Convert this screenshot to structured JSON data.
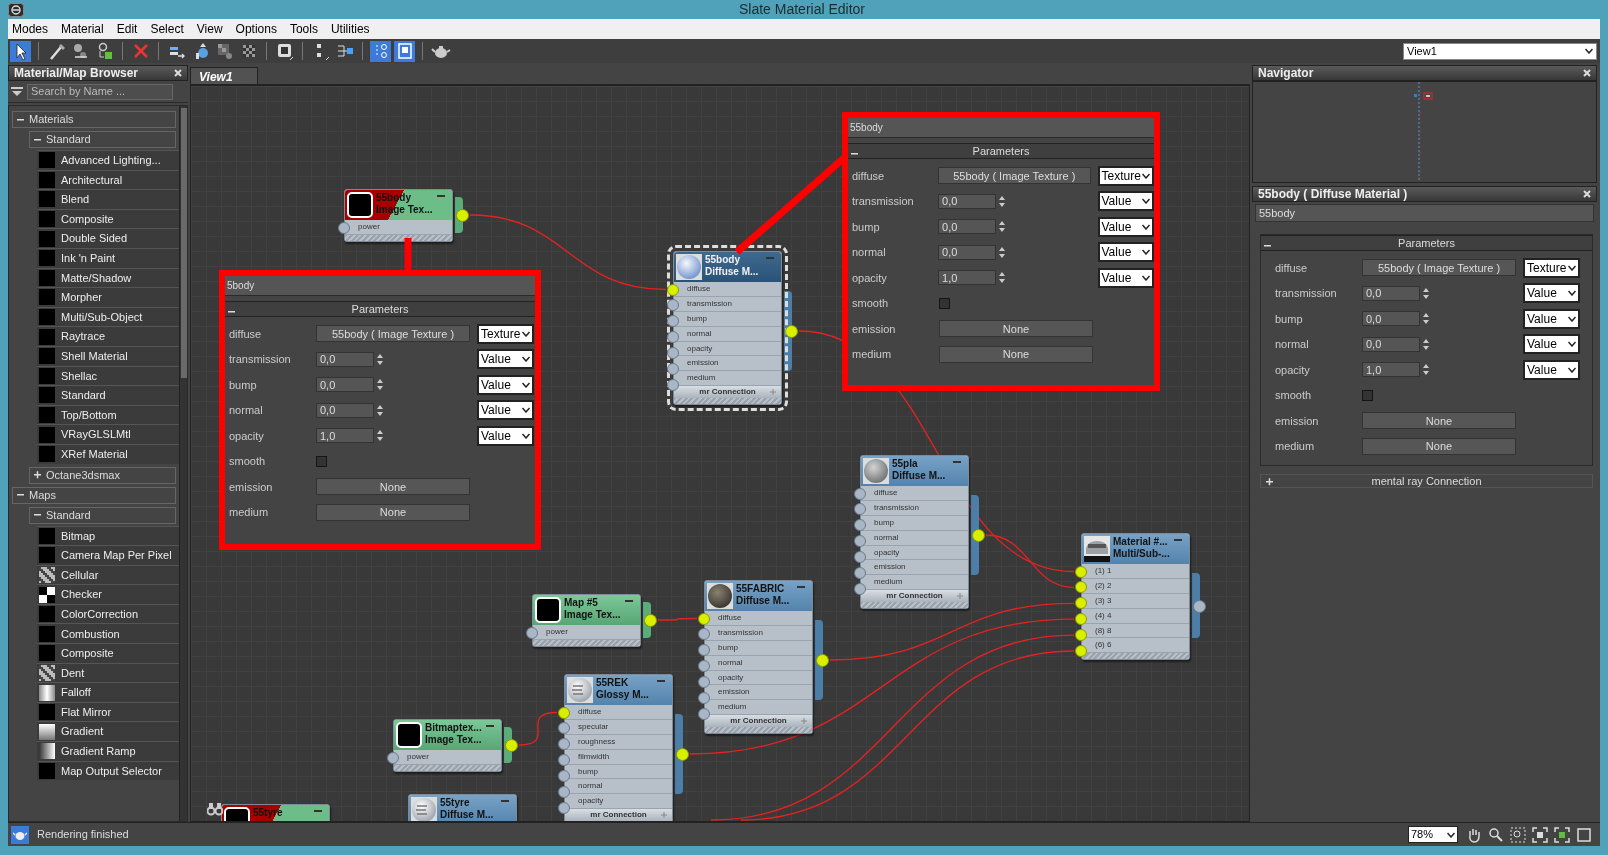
{
  "window": {
    "title": "Slate Material Editor"
  },
  "menu": [
    "Modes",
    "Material",
    "Edit",
    "Select",
    "View",
    "Options",
    "Tools",
    "Utilities"
  ],
  "toolbar": [
    [
      {
        "kind": "select",
        "selected": true
      }
    ],
    [
      {
        "kind": "pick",
        "selected": false
      },
      {
        "kind": "put",
        "selected": false
      },
      {
        "kind": "assign",
        "selected": false
      }
    ],
    [
      {
        "kind": "delete",
        "selected": false
      }
    ],
    [
      {
        "kind": "movechildren",
        "selected": false
      },
      {
        "kind": "hideunused",
        "selected": false
      },
      {
        "kind": "shaded",
        "selected": false
      },
      {
        "kind": "background",
        "selected": false
      }
    ],
    [
      {
        "kind": "showmap",
        "selected": false
      }
    ],
    [
      {
        "kind": "layoutall",
        "selected": false
      },
      {
        "kind": "layoutchildren",
        "selected": false
      }
    ],
    [
      {
        "kind": "navigator",
        "selected": true
      },
      {
        "kind": "parameters",
        "selected": true
      }
    ],
    [
      {
        "kind": "render",
        "selected": false
      }
    ]
  ],
  "view_selector": "View1",
  "browser": {
    "title": "Material/Map Browser",
    "search": {
      "placeholder": "Search by Name ..."
    },
    "groups": [
      {
        "label": "Materials",
        "expanded": true,
        "children": [
          {
            "label": "Standard",
            "expanded": true,
            "children": [
              {
                "label": "Advanced Lighting...",
                "kind": "black"
              },
              {
                "label": "Architectural",
                "kind": "black"
              },
              {
                "label": "Blend",
                "kind": "black"
              },
              {
                "label": "Composite",
                "kind": "black"
              },
              {
                "label": "Double Sided",
                "kind": "black"
              },
              {
                "label": "Ink 'n Paint",
                "kind": "black"
              },
              {
                "label": "Matte/Shadow",
                "kind": "black"
              },
              {
                "label": "Morpher",
                "kind": "black"
              },
              {
                "label": "Multi/Sub-Object",
                "kind": "black"
              },
              {
                "label": "Raytrace",
                "kind": "black"
              },
              {
                "label": "Shell Material",
                "kind": "black"
              },
              {
                "label": "Shellac",
                "kind": "black"
              },
              {
                "label": "Standard",
                "kind": "black"
              },
              {
                "label": "Top/Bottom",
                "kind": "black"
              },
              {
                "label": "VRayGLSLMtl",
                "kind": "black"
              },
              {
                "label": "XRef Material",
                "kind": "black"
              }
            ]
          },
          {
            "label": "Octane3dsmax",
            "expanded": false
          }
        ]
      },
      {
        "label": "Maps",
        "expanded": true,
        "children": [
          {
            "label": "Standard",
            "expanded": true,
            "children": [
              {
                "label": "Bitmap",
                "kind": "black"
              },
              {
                "label": "Camera Map Per Pixel",
                "kind": "black"
              },
              {
                "label": "Cellular",
                "kind": "noise"
              },
              {
                "label": "Checker",
                "kind": "checker"
              },
              {
                "label": "ColorCorrection",
                "kind": "black"
              },
              {
                "label": "Combustion",
                "kind": "black"
              },
              {
                "label": "Composite",
                "kind": "black"
              },
              {
                "label": "Dent",
                "kind": "noise"
              },
              {
                "label": "Falloff",
                "kind": "falloff"
              },
              {
                "label": "Flat Mirror",
                "kind": "black"
              },
              {
                "label": "Gradient",
                "kind": "gradient"
              },
              {
                "label": "Gradient Ramp",
                "kind": "ramp"
              },
              {
                "label": "Map Output Selector",
                "kind": "black"
              }
            ]
          }
        ]
      }
    ]
  },
  "view": {
    "tab": "View1",
    "nodes": [
      {
        "kind": "map",
        "title": "55body",
        "subtitle": "Image Tex...",
        "thumbnail": {
          "kind": "black"
        },
        "selected": false,
        "shown_in_viewport": true,
        "ports": [
          {
            "label": "power",
            "connected": false
          }
        ],
        "output_connected": true
      },
      {
        "kind": "material",
        "title": "55body",
        "subtitle": "Diffuse M...",
        "thumbnail": {
          "kind": "pale"
        },
        "selected": true,
        "shown_in_viewport": false,
        "ports": [
          {
            "label": "diffuse",
            "connected": true
          },
          {
            "label": "transmission",
            "connected": false
          },
          {
            "label": "bump",
            "connected": false
          },
          {
            "label": "normal",
            "connected": false
          },
          {
            "label": "opacity",
            "connected": false
          },
          {
            "label": "emission",
            "connected": false
          },
          {
            "label": "medium",
            "connected": false
          }
        ],
        "footer": "mr Connection",
        "output_connected": true
      },
      {
        "kind": "material",
        "title": "55pla",
        "subtitle": "Diffuse M...",
        "thumbnail": {
          "kind": "grey"
        },
        "selected": false,
        "shown_in_viewport": false,
        "ports": [
          {
            "label": "diffuse",
            "connected": false
          },
          {
            "label": "transmission",
            "connected": false
          },
          {
            "label": "bump",
            "connected": false
          },
          {
            "label": "normal",
            "connected": false
          },
          {
            "label": "opacity",
            "connected": false
          },
          {
            "label": "emission",
            "connected": false
          },
          {
            "label": "medium",
            "connected": false
          }
        ],
        "footer": "mr Connection",
        "output_connected": true
      },
      {
        "kind": "material",
        "title": "Material #...",
        "subtitle": "Multi/Sub-...",
        "thumbnail": {
          "kind": "car"
        },
        "selected": false,
        "shown_in_viewport": false,
        "ports": [
          {
            "label": "(1) 1",
            "connected": true
          },
          {
            "label": "(2) 2",
            "connected": true
          },
          {
            "label": "(3) 3",
            "connected": true
          },
          {
            "label": "(4) 4",
            "connected": true
          },
          {
            "label": "(8) 8",
            "connected": true
          },
          {
            "label": "(6) 6",
            "connected": true
          }
        ],
        "output_connected": false
      },
      {
        "kind": "map",
        "title": "Map #5",
        "subtitle": "Image Tex...",
        "thumbnail": {
          "kind": "black"
        },
        "selected": false,
        "shown_in_viewport": false,
        "ports": [
          {
            "label": "power",
            "connected": false
          }
        ],
        "output_connected": true
      },
      {
        "kind": "material",
        "title": "55FABRIC",
        "subtitle": "Diffuse M...",
        "thumbnail": {
          "kind": "dark"
        },
        "selected": false,
        "shown_in_viewport": false,
        "ports": [
          {
            "label": "diffuse",
            "connected": true
          },
          {
            "label": "transmission",
            "connected": false
          },
          {
            "label": "bump",
            "connected": false
          },
          {
            "label": "normal",
            "connected": false
          },
          {
            "label": "opacity",
            "connected": false
          },
          {
            "label": "emission",
            "connected": false
          },
          {
            "label": "medium",
            "connected": false
          }
        ],
        "footer": "mr Connection",
        "output_connected": true
      },
      {
        "kind": "map",
        "title": "55tyre",
        "thumbnail": {
          "kind": "black"
        },
        "selected": false,
        "shown_in_viewport": true
      },
      {
        "kind": "map",
        "title": "Bitmaptex...",
        "subtitle": "Image Tex...",
        "thumbnail": {
          "kind": "black"
        },
        "selected": false,
        "shown_in_viewport": false,
        "ports": [
          {
            "label": "power",
            "connected": false
          }
        ],
        "output_connected": true
      },
      {
        "kind": "material",
        "title": "55tyre",
        "subtitle": "Diffuse M...",
        "thumbnail": {
          "kind": "striped"
        },
        "selected": false,
        "shown_in_viewport": false
      },
      {
        "kind": "material",
        "title": "55REK",
        "subtitle": "Glossy M...",
        "thumbnail": {
          "kind": "striped"
        },
        "selected": false,
        "shown_in_viewport": false,
        "ports": [
          {
            "label": "diffuse",
            "connected": true
          },
          {
            "label": "specular",
            "connected": false
          },
          {
            "label": "roughness",
            "connected": false
          },
          {
            "label": "filmwidth",
            "connected": false
          },
          {
            "label": "bump",
            "connected": false
          },
          {
            "label": "normal",
            "connected": false
          },
          {
            "label": "opacity",
            "connected": false
          }
        ],
        "footer": "mr Connection",
        "output_connected": true
      }
    ],
    "callouts": [
      {
        "title": "5body",
        "rollout": {
          "label": "Parameters",
          "expanded": true
        },
        "rows": [
          {
            "label": "diffuse",
            "kind": "map",
            "value": "55body ( Image Texture )",
            "source": "Texture"
          },
          {
            "label": "transmission",
            "kind": "spinner",
            "value": "0,0",
            "source": "Value"
          },
          {
            "label": "bump",
            "kind": "spinner",
            "value": "0,0",
            "source": "Value"
          },
          {
            "label": "normal",
            "kind": "spinner",
            "value": "0,0",
            "source": "Value"
          },
          {
            "label": "opacity",
            "kind": "spinner",
            "value": "1,0",
            "source": "Value"
          },
          {
            "label": "smooth",
            "kind": "checkbox",
            "checked": false
          },
          {
            "label": "emission",
            "kind": "map",
            "value": "None"
          },
          {
            "label": "medium",
            "kind": "map",
            "value": "None"
          }
        ]
      },
      {
        "title": "55body",
        "rollout": {
          "label": "Parameters",
          "expanded": true
        },
        "rows": [
          {
            "label": "diffuse",
            "kind": "map",
            "value": "55body ( Image Texture )",
            "source": "Texture"
          },
          {
            "label": "transmission",
            "kind": "spinner",
            "value": "0,0",
            "source": "Value"
          },
          {
            "label": "bump",
            "kind": "spinner",
            "value": "0,0",
            "source": "Value"
          },
          {
            "label": "normal",
            "kind": "spinner",
            "value": "0,0",
            "source": "Value"
          },
          {
            "label": "opacity",
            "kind": "spinner",
            "value": "1,0",
            "source": "Value"
          },
          {
            "label": "smooth",
            "kind": "checkbox",
            "checked": false
          },
          {
            "label": "emission",
            "kind": "map",
            "value": "None"
          },
          {
            "label": "medium",
            "kind": "map",
            "value": "None"
          }
        ]
      }
    ]
  },
  "navigator": {
    "title": "Navigator"
  },
  "properties": {
    "title": "55body ( Diffuse Material )",
    "name": "55body",
    "rollouts": [
      {
        "label": "Parameters",
        "expanded": true,
        "rows": [
          {
            "label": "diffuse",
            "kind": "map",
            "value": "55body ( Image Texture )",
            "source": "Texture"
          },
          {
            "label": "transmission",
            "kind": "spinner",
            "value": "0,0",
            "source": "Value"
          },
          {
            "label": "bump",
            "kind": "spinner",
            "value": "0,0",
            "source": "Value"
          },
          {
            "label": "normal",
            "kind": "spinner",
            "value": "0,0",
            "source": "Value"
          },
          {
            "label": "opacity",
            "kind": "spinner",
            "value": "1,0",
            "source": "Value"
          },
          {
            "label": "smooth",
            "kind": "checkbox",
            "checked": false
          },
          {
            "label": "emission",
            "kind": "map",
            "value": "None"
          },
          {
            "label": "medium",
            "kind": "map",
            "value": "None"
          }
        ]
      },
      {
        "label": "mental ray Connection",
        "expanded": false
      }
    ]
  },
  "status_bar": {
    "message": "Rendering finished",
    "zoom": "78%"
  }
}
